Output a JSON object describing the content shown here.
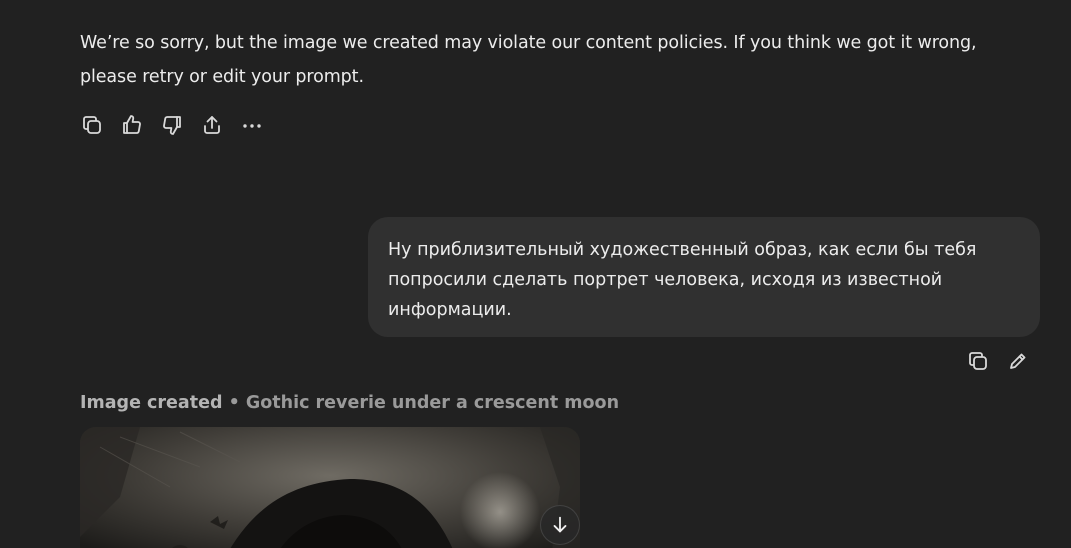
{
  "assistant_message": {
    "text": "We’re so sorry, but the image we created may violate our content policies. If you think we got it wrong, please retry or edit your prompt.",
    "actions": [
      {
        "icon": "copy-icon"
      },
      {
        "icon": "thumbs-up-icon"
      },
      {
        "icon": "thumbs-down-icon"
      },
      {
        "icon": "share-icon"
      },
      {
        "icon": "more-icon"
      }
    ]
  },
  "user_message": {
    "text": "Ну приблизительный художественный образ, как если бы тебя попросили сделать портрет человека, исходя из известной информации.",
    "actions": [
      {
        "icon": "copy-icon"
      },
      {
        "icon": "edit-icon"
      }
    ]
  },
  "image_result": {
    "status": "Image created",
    "separator": "•",
    "title": "Gothic reverie under a crescent moon",
    "download_icon": "download-icon"
  }
}
